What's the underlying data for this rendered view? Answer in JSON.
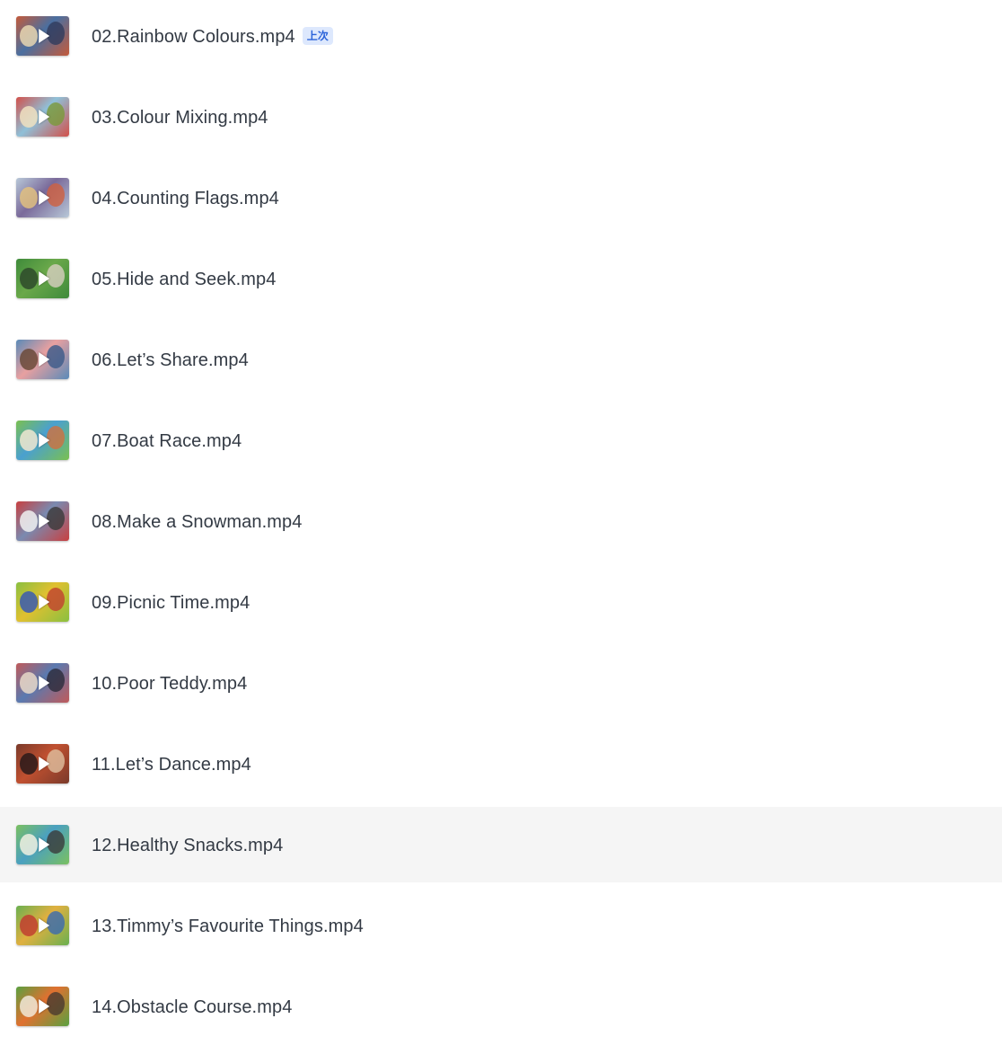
{
  "badge_last": "上次",
  "files": [
    {
      "name": "02.Rainbow Colours.mp4",
      "last_viewed": true,
      "hovered": false,
      "thumb": {
        "colors": [
          "#c45a3a",
          "#4a6fa0",
          "#e8d6b0",
          "#2f3b5c"
        ]
      }
    },
    {
      "name": "03.Colour Mixing.mp4",
      "last_viewed": false,
      "hovered": false,
      "thumb": {
        "colors": [
          "#d2504a",
          "#8fc0d8",
          "#f0e0c0",
          "#7a9a3a"
        ]
      }
    },
    {
      "name": "04.Counting Flags.mp4",
      "last_viewed": false,
      "hovered": false,
      "thumb": {
        "colors": [
          "#b8c8d8",
          "#7a6a9a",
          "#e0c080",
          "#d06040"
        ]
      }
    },
    {
      "name": "05.Hide and Seek.mp4",
      "last_viewed": false,
      "hovered": false,
      "thumb": {
        "colors": [
          "#3e8a3a",
          "#6aa84a",
          "#2e4a2a",
          "#d8d0c0"
        ]
      }
    },
    {
      "name": "06.Let’s Share.mp4",
      "last_viewed": false,
      "hovered": false,
      "thumb": {
        "colors": [
          "#5a8ab8",
          "#e8a0a0",
          "#6a4a3a",
          "#3a5a8a"
        ]
      }
    },
    {
      "name": "07.Boat Race.mp4",
      "last_viewed": false,
      "hovered": false,
      "thumb": {
        "colors": [
          "#7ac050",
          "#4aa0d0",
          "#f0e8d0",
          "#d07040"
        ]
      }
    },
    {
      "name": "08.Make a Snowman.mp4",
      "last_viewed": false,
      "hovered": false,
      "thumb": {
        "colors": [
          "#c84040",
          "#7a8ab0",
          "#f0f0f0",
          "#3a3a3a"
        ]
      }
    },
    {
      "name": "09.Picnic Time.mp4",
      "last_viewed": false,
      "hovered": false,
      "thumb": {
        "colors": [
          "#8ac040",
          "#e0c030",
          "#3a5ab0",
          "#c04030"
        ]
      }
    },
    {
      "name": "10.Poor Teddy.mp4",
      "last_viewed": false,
      "hovered": false,
      "thumb": {
        "colors": [
          "#c05a5a",
          "#5a7ab0",
          "#e8d8c8",
          "#2a2a3a"
        ]
      }
    },
    {
      "name": "11.Let’s Dance.mp4",
      "last_viewed": false,
      "hovered": false,
      "thumb": {
        "colors": [
          "#7a3a2a",
          "#c05030",
          "#2a1a1a",
          "#e0c0a0"
        ]
      }
    },
    {
      "name": "12.Healthy Snacks.mp4",
      "last_viewed": false,
      "hovered": true,
      "thumb": {
        "colors": [
          "#7ac060",
          "#4aa0c0",
          "#f0f0e0",
          "#3a3a3a"
        ]
      }
    },
    {
      "name": "13.Timmy’s Favourite Things.mp4",
      "last_viewed": false,
      "hovered": false,
      "thumb": {
        "colors": [
          "#6ab050",
          "#e0b040",
          "#c04030",
          "#3a6ab0"
        ]
      }
    },
    {
      "name": "14.Obstacle Course.mp4",
      "last_viewed": false,
      "hovered": false,
      "thumb": {
        "colors": [
          "#5aa040",
          "#e07030",
          "#f0e8d8",
          "#4a3a30"
        ]
      }
    }
  ]
}
